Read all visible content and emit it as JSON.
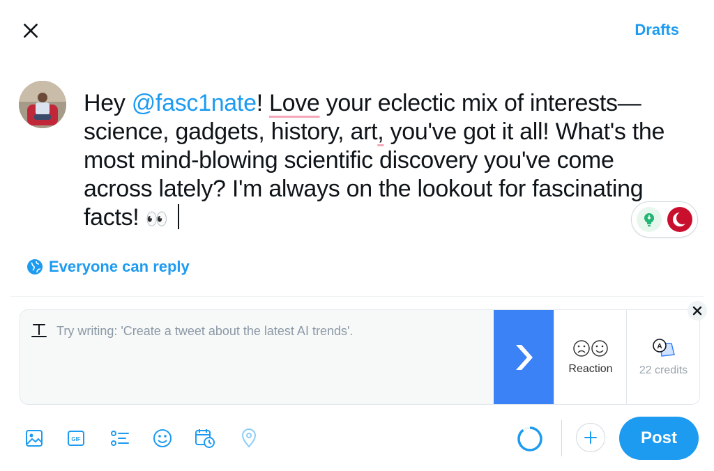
{
  "header": {
    "close_icon": "close-icon",
    "drafts_label": "Drafts"
  },
  "composer": {
    "avatar_icon": "user-avatar",
    "text_parts": {
      "greeting": "Hey ",
      "mention": "@fasc1nate",
      "bang": "! ",
      "word_love": "Love",
      "rest1": " your eclectic mix of interests—science, gadgets, history, art",
      "comma": ",",
      "rest2": " you've got it all! What's the most mind-blowing scientific discovery you've come across lately? I'm always on the lookout for fascinating facts! ",
      "emoji": "👀"
    }
  },
  "extensions": {
    "icons": [
      "lightbulb-icon",
      "crescent-icon"
    ]
  },
  "reply_setting": {
    "icon": "globe-icon",
    "label": "Everyone can reply"
  },
  "assistant": {
    "placeholder": "Try writing: 'Create a tweet about the latest AI trends'.",
    "reaction_label": "Reaction",
    "credits_label": "22 credits",
    "colors": {
      "go_button": "#3b82f6"
    }
  },
  "toolbar": {
    "icons": [
      "image-icon",
      "gif-icon",
      "poll-icon",
      "emoji-icon",
      "schedule-icon",
      "location-icon"
    ],
    "post_label": "Post"
  },
  "colors": {
    "accent": "#1d9bf0",
    "text": "#0f1419"
  }
}
